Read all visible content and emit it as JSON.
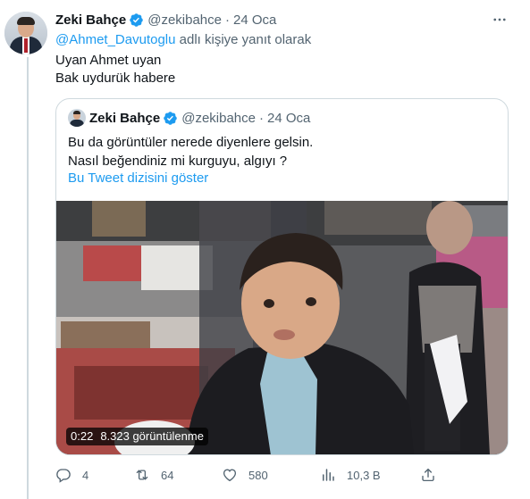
{
  "tweet": {
    "author_name": "Zeki Bahçe",
    "handle": "@zekibahce",
    "separator": "·",
    "date": "24 Oca",
    "reply_mention": "@Ahmet_Davutoglu",
    "reply_suffix": " adlı kişiye yanıt olarak",
    "lines": [
      "Uyan Ahmet uyan",
      "Bak uydurük habere"
    ]
  },
  "quote": {
    "author_name": "Zeki Bahçe",
    "handle": "@zekibahce",
    "separator": "·",
    "date": "24 Oca",
    "lines": [
      "Bu da görüntüler nerede diyenlere gelsin.",
      "Nasıl beğendiniz mi kurguyu, algıyı ?"
    ],
    "show_thread": "Bu Tweet dizisini göster",
    "video": {
      "duration": "0:22",
      "views": "8.323 görüntülenme"
    }
  },
  "actions": {
    "replies": "4",
    "retweets": "64",
    "likes": "580",
    "views": "10,3 B"
  },
  "icons": {
    "verified": "verified-badge-icon",
    "more": "more-icon",
    "reply": "reply-icon",
    "retweet": "retweet-icon",
    "like": "like-icon",
    "views": "views-icon",
    "share": "share-icon"
  },
  "colors": {
    "accent": "#1d9bf0",
    "secondary_text": "#536471",
    "border": "#cfd9de"
  }
}
